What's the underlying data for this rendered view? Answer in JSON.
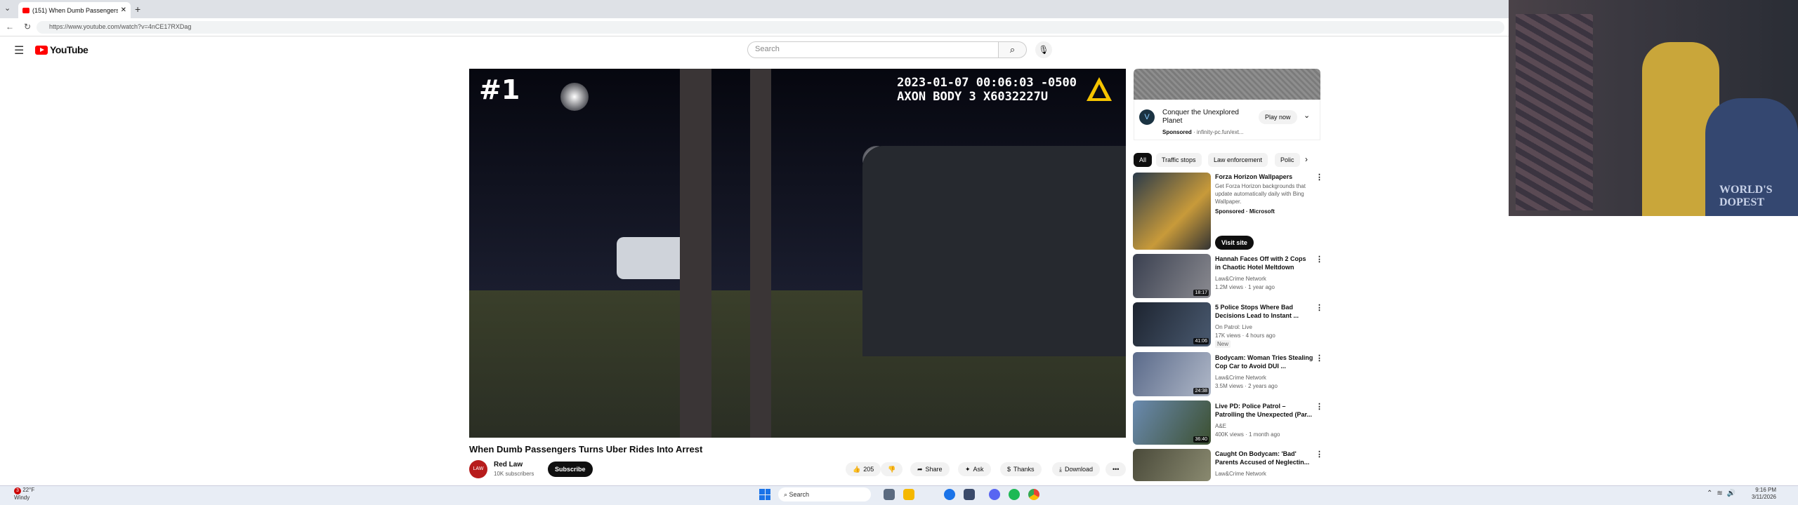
{
  "browser": {
    "tab_title": "(151) When Dumb Passengers",
    "url": "https://www.youtube.com/watch?v=4nCE17RXDag",
    "new_tab": "+",
    "tab_close": "✕"
  },
  "youtube": {
    "logo_text": "YouTube",
    "search_placeholder": "Search"
  },
  "video": {
    "overlay_rank": "#1",
    "overlay_timestamp": "2023-01-07 00:06:03 -0500",
    "overlay_device": "AXON BODY 3 X6032227U",
    "title": "When Dumb Passengers Turns Uber Rides Into Arrest",
    "channel_name": "Red Law",
    "channel_avatar": "LAW",
    "channel_subs": "10K subscribers",
    "subscribe_label": "Subscribe",
    "like_count": "205",
    "share_label": "Share",
    "ask_label": "Ask",
    "thanks_label": "Thanks",
    "download_label": "Download",
    "more_label": "•••"
  },
  "sidebar_ad": {
    "title": "Conquer the Unexplored Planet",
    "sponsored": "Sponsored",
    "advertiser": "· infinity-pc.fun/ext...",
    "cta": "Play now",
    "icon": "V"
  },
  "chips": [
    "All",
    "Traffic stops",
    "Law enforcement",
    "Polic"
  ],
  "recommendations": [
    {
      "title": "Forza Horizon Wallpapers",
      "desc": "Get Forza Horizon backgrounds that update automatically daily with Bing Wallpaper.",
      "channel": "Sponsored · Microsoft",
      "meta": "",
      "duration": "",
      "cta": "Visit site"
    },
    {
      "title": "Hannah Faces Off with 2 Cops in Chaotic Hotel Meltdown",
      "channel": "Law&Crime Network",
      "meta": "1.2M views · 1 year ago",
      "duration": "18:17"
    },
    {
      "title": "5 Police Stops Where Bad Decisions Lead to Instant ...",
      "channel": "On Patrol: Live",
      "meta": "17K views · 4 hours ago",
      "badge": "New",
      "duration": "41:06"
    },
    {
      "title": "Bodycam: Woman Tries Stealing Cop Car to Avoid DUI ...",
      "channel": "Law&Crime Network",
      "meta": "3.5M views · 2 years ago",
      "duration": "24:38"
    },
    {
      "title": "Live PD: Police Patrol – Patrolling the Unexpected (Par...",
      "channel": "A&E",
      "meta": "400K views · 1 month ago",
      "duration": "36:40"
    },
    {
      "title": "Caught On Bodycam: 'Bad' Parents Accused of Neglectin...",
      "channel": "Law&Crime Network",
      "meta": "",
      "duration": ""
    }
  ],
  "webcam": {
    "shirt_text": "WORLD'S DOPEST"
  },
  "taskbar": {
    "weather_temp": "22°F",
    "weather_desc": "Windy",
    "notification_count": "3",
    "search_label": "Search",
    "time": "9:16 PM",
    "date": "3/11/2026"
  },
  "colors": {
    "youtube_red": "#ff0000",
    "subscribe_bg": "#0f0f0f",
    "chip_bg": "#f2f2f2"
  }
}
